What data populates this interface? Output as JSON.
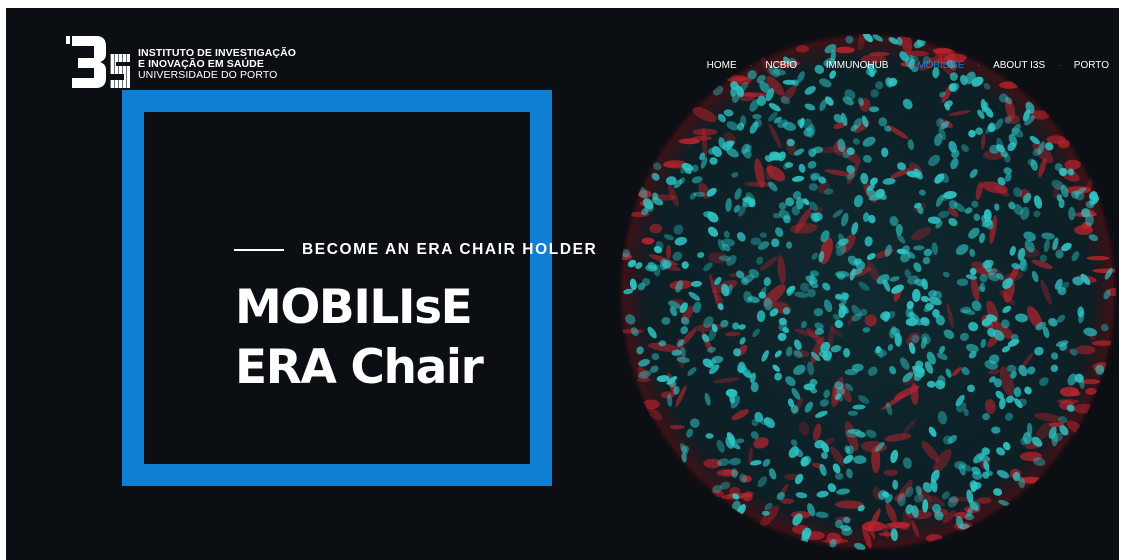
{
  "logo": {
    "mark": "i3S",
    "line1": "INSTITUTO DE INVESTIGAÇÃO",
    "line2": "E INOVAÇÃO EM SAÚDE",
    "line3": "UNIVERSIDADE DO PORTO"
  },
  "nav": {
    "items": [
      {
        "label": "HOME",
        "active": false
      },
      {
        "label": "NCBIO",
        "active": false
      },
      {
        "label": "IMMUNOHUB",
        "active": false
      },
      {
        "label": "MOBILISE",
        "active": true
      },
      {
        "label": "ABOUT I3S",
        "active": false
      },
      {
        "label": "PORTO",
        "active": false
      }
    ],
    "separator": "·"
  },
  "hero": {
    "tagline": "BECOME AN ERA CHAIR HOLDER",
    "headline_line1": "MOBILIsE",
    "headline_line2": "ERA Chair"
  },
  "colors": {
    "background": "#0b0e13",
    "accent_blue": "#0f7fd3",
    "nav_active": "#1a7fd0",
    "nuclei_cyan": "#2fc5c5",
    "membrane_red": "#c0242e"
  }
}
